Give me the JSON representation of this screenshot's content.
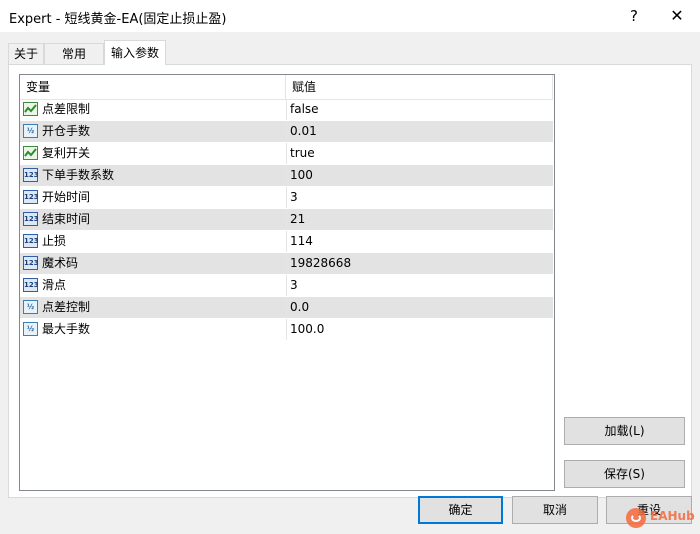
{
  "window": {
    "title": "Expert - 短线黄金-EA(固定止损止盈)",
    "help_glyph": "?",
    "close_glyph": "✕"
  },
  "tabs": [
    {
      "label": "关于",
      "active": false
    },
    {
      "label": "常用",
      "active": false
    },
    {
      "label": "输入参数",
      "active": true
    }
  ],
  "table": {
    "headers": {
      "variable": "变量",
      "value": "赋值"
    },
    "rows": [
      {
        "icon": "bool-icon",
        "name": "点差限制",
        "value": "false"
      },
      {
        "icon": "double-icon",
        "name": "开仓手数",
        "value": "0.01"
      },
      {
        "icon": "bool-icon",
        "name": "复利开关",
        "value": "true"
      },
      {
        "icon": "int-icon",
        "name": "下单手数系数",
        "value": "100"
      },
      {
        "icon": "int-icon",
        "name": "开始时间",
        "value": "3"
      },
      {
        "icon": "int-icon",
        "name": "结束时间",
        "value": "21"
      },
      {
        "icon": "int-icon",
        "name": "止损",
        "value": "114"
      },
      {
        "icon": "int-icon",
        "name": "魔术码",
        "value": "19828668"
      },
      {
        "icon": "int-icon",
        "name": "滑点",
        "value": "3"
      },
      {
        "icon": "double-icon",
        "name": "点差控制",
        "value": "0.0"
      },
      {
        "icon": "double-icon",
        "name": "最大手数",
        "value": "100.0"
      }
    ]
  },
  "icon_glyphs": {
    "double": "½",
    "int": "123"
  },
  "buttons": {
    "load": "加载(L)",
    "save": "保存(S)",
    "ok": "确定",
    "cancel": "取消",
    "reset": "重设"
  },
  "watermark": {
    "text": "EAHub"
  },
  "colors": {
    "accent": "#0078d7",
    "alt_row": "#e3e3e3",
    "watermark": "#f56a3b"
  }
}
